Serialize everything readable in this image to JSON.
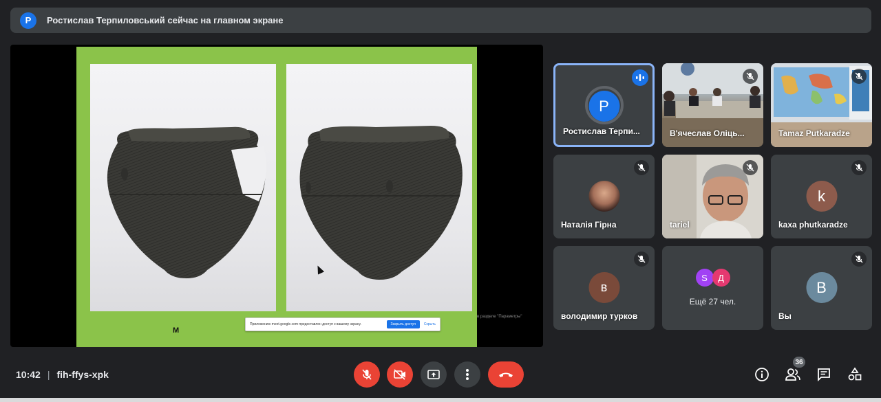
{
  "banner": {
    "avatar_letter": "Р",
    "text": "Ростислав Терпиловський сейчас на главном экране"
  },
  "presentation": {
    "caption": "М",
    "notice_text": "Приложению meet.google.com предоставлен доступ к вашему экрану.",
    "notice_button": "Закрыть доступ",
    "notice_link": "Скрыть",
    "side_hint": "в разделе \"Параметры\""
  },
  "participants": [
    {
      "name": "Ростислав Терпи...",
      "letter": "P",
      "color": "#1a73e8",
      "speaking": true
    },
    {
      "name": "В'ячеслав Оліць...",
      "letter": "",
      "video": true,
      "muted": true
    },
    {
      "name": "Tamaz Putkaradze",
      "letter": "",
      "video": true,
      "muted": true
    },
    {
      "name": "Наталія Гірна",
      "letter": "",
      "photo": true,
      "muted": true
    },
    {
      "name": "tariel",
      "letter": "",
      "video": true,
      "muted": true
    },
    {
      "name": "kaxa phutkaradze",
      "letter": "k",
      "color": "#8d5b4c",
      "muted": true
    },
    {
      "name": "володимир турков",
      "letter": "в",
      "color": "#7a4a3a",
      "muted": true
    },
    {
      "name": "Ещё 27 чел.",
      "letter": "",
      "more": true,
      "avatars": [
        {
          "letter": "S",
          "color": "#a142f4"
        },
        {
          "letter": "Д",
          "color": "#e53970"
        }
      ]
    },
    {
      "name": "Вы",
      "letter": "В",
      "color": "#6b8a9e",
      "muted": true
    }
  ],
  "bottom": {
    "time": "10:42",
    "separator": "|",
    "meeting_code": "fih-ffys-xpk",
    "people_count": "36"
  },
  "colors": {
    "background": "#202124",
    "tile": "#3c4043",
    "danger": "#ea4335",
    "accent": "#1a73e8",
    "slide": "#8bc34a"
  }
}
